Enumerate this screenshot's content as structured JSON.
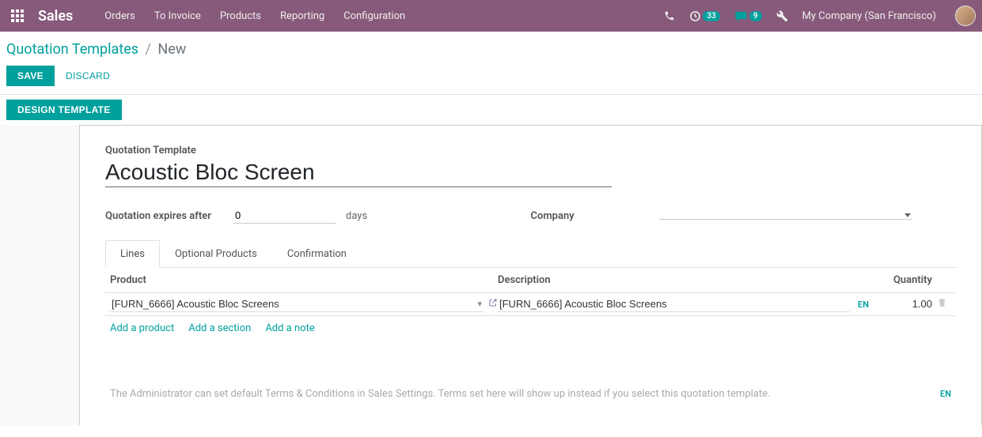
{
  "navbar": {
    "brand": "Sales",
    "menu": [
      "Orders",
      "To Invoice",
      "Products",
      "Reporting",
      "Configuration"
    ],
    "activity_count": "33",
    "messages_count": "9",
    "company": "My Company (San Francisco)"
  },
  "breadcrumb": {
    "parent": "Quotation Templates",
    "current": "New"
  },
  "buttons": {
    "save": "SAVE",
    "discard": "DISCARD",
    "design": "DESIGN TEMPLATE"
  },
  "form": {
    "title_label": "Quotation Template",
    "title_value": "Acoustic Bloc Screen",
    "expires_label": "Quotation expires after",
    "expires_value": "0",
    "expires_unit": "days",
    "company_label": "Company",
    "company_value": ""
  },
  "tabs": [
    "Lines",
    "Optional Products",
    "Confirmation"
  ],
  "grid": {
    "headers": {
      "product": "Product",
      "description": "Description",
      "quantity": "Quantity"
    },
    "rows": [
      {
        "product": "[FURN_6666] Acoustic Bloc Screens",
        "description": "[FURN_6666] Acoustic Bloc Screens",
        "quantity": "1.00"
      }
    ],
    "lang_badge": "EN",
    "add_product": "Add a product",
    "add_section": "Add a section",
    "add_note": "Add a note"
  },
  "footer": {
    "placeholder": "The Administrator can set default Terms & Conditions in Sales Settings. Terms set here will show up instead if you select this quotation template.",
    "lang_badge": "EN"
  }
}
